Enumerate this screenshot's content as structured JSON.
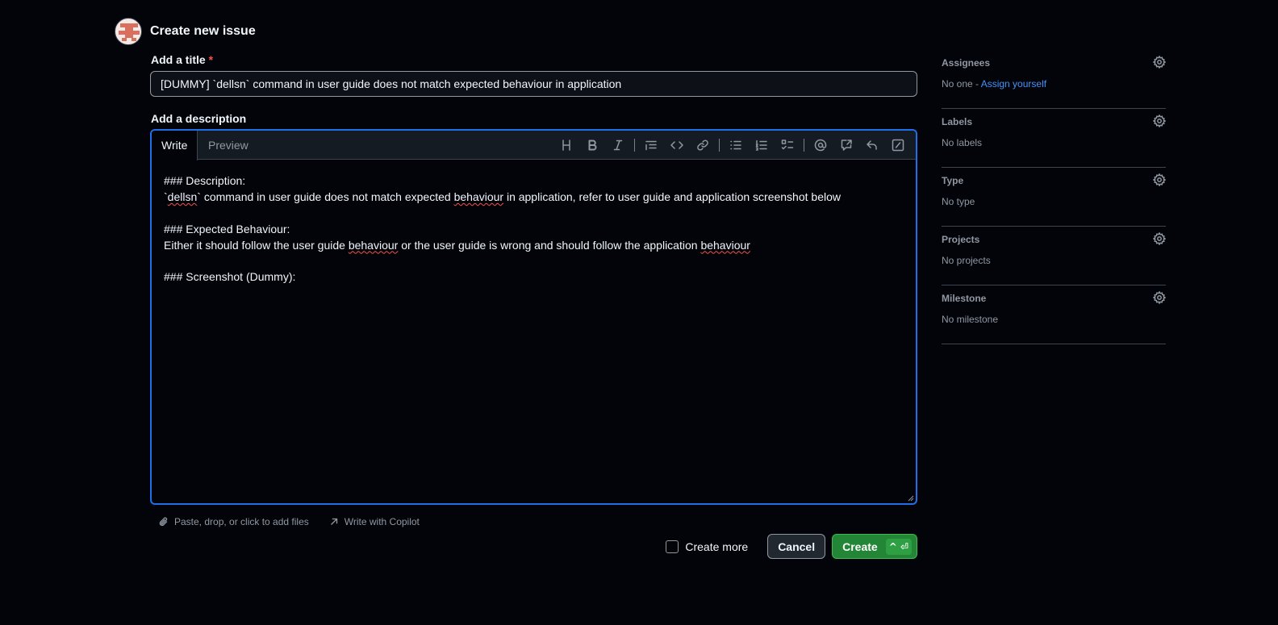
{
  "header": {
    "title": "Create new issue"
  },
  "title_field": {
    "label": "Add a title",
    "required_mark": "*",
    "value": "[DUMMY] `dellsn` command in user guide does not match expected behaviour in application"
  },
  "description": {
    "label": "Add a description",
    "tabs": {
      "write": "Write",
      "preview": "Preview"
    },
    "lines": {
      "l1": "### Description:",
      "l2a": "`",
      "l2b": "dellsn",
      "l2c": "` command in user guide does not match expected ",
      "l2d": "behaviour",
      "l2e": " in application, refer to user guide and application screenshot below",
      "l3": "### Expected Behaviour:",
      "l4a": "Either it should follow the user guide ",
      "l4b": "behaviour",
      "l4c": " or the user guide is wrong and should follow the application ",
      "l4d": "behaviour",
      "l5": "### Screenshot (Dummy):"
    }
  },
  "footer": {
    "attach": "Paste, drop, or click to add files",
    "copilot": "Write with Copilot"
  },
  "actions": {
    "create_more": "Create more",
    "cancel": "Cancel",
    "create": "Create",
    "shortcut": "^ ⏎"
  },
  "sidebar": {
    "assignees": {
      "title": "Assignees",
      "value": "No one - ",
      "link": "Assign yourself"
    },
    "labels": {
      "title": "Labels",
      "value": "No labels"
    },
    "type": {
      "title": "Type",
      "value": "No type"
    },
    "projects": {
      "title": "Projects",
      "value": "No projects"
    },
    "milestone": {
      "title": "Milestone",
      "value": "No milestone"
    }
  },
  "colors": {
    "accent": "#1f6feb",
    "create_green": "#238636",
    "link_blue": "#4493f8",
    "background": "#02040a"
  }
}
